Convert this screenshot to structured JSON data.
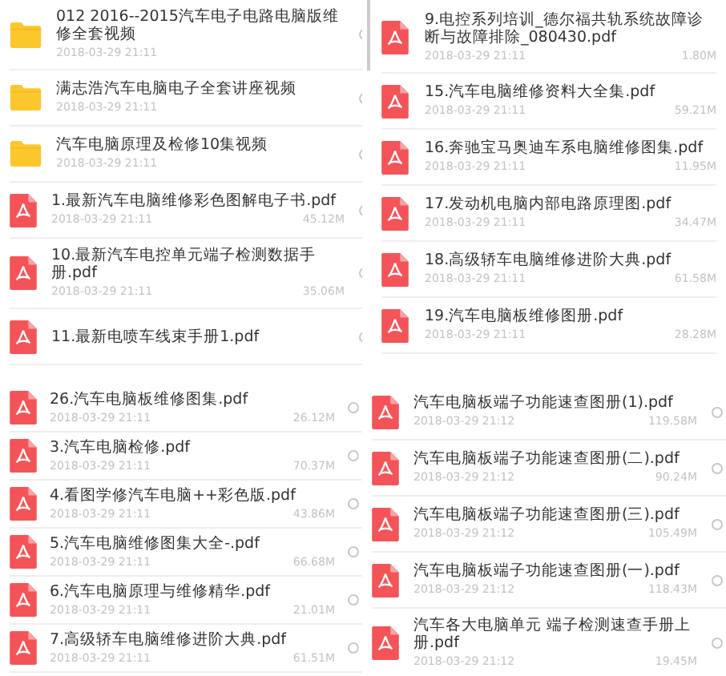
{
  "panels": [
    {
      "rows": [
        {
          "kind": "folder",
          "name": "012 2016--2015汽车电子电路电脑版维修全套视频",
          "date": "2018-03-29 21:11",
          "selected": false
        },
        {
          "kind": "folder",
          "name": "满志浩汽车电脑电子全套讲座视频",
          "date": "2018-03-29 21:11",
          "selected": false
        },
        {
          "kind": "folder",
          "name": "汽车电脑原理及检修10集视频",
          "date": "2018-03-29 21:11",
          "selected": false
        },
        {
          "kind": "pdf",
          "name": "1.最新汽车电脑维修彩色图解电子书.pdf",
          "date": "2018-03-29 21:11",
          "size": "45.12M",
          "selected": false
        },
        {
          "kind": "pdf",
          "name": "10.最新汽车电控单元端子检测数据手册.pdf",
          "date": "2018-03-29 21:11",
          "size": "35.06M",
          "selected": false
        },
        {
          "kind": "pdf",
          "name": "11.最新电喷车线束手册1.pdf",
          "selected": false
        }
      ]
    },
    {
      "scrollbar": true,
      "rows": [
        {
          "kind": "pdf",
          "name": "9.电控系列培训_德尔福共轨系统故障诊断与故障排除_080430.pdf",
          "date": "2018-03-29 21:11",
          "size": "1.80M"
        },
        {
          "kind": "pdf",
          "name": "15.汽车电脑维修资料大全集.pdf",
          "date": "2018-03-29 21:11",
          "size": "59.21M"
        },
        {
          "kind": "pdf",
          "name": "16.奔驰宝马奥迪车系电脑维修图集.pdf",
          "date": "2018-03-29 21:11",
          "size": "11.95M"
        },
        {
          "kind": "pdf",
          "name": "17.发动机电脑内部电路原理图.pdf",
          "date": "2018-03-29 21:11",
          "size": "34.47M"
        },
        {
          "kind": "pdf",
          "name": "18.高级轿车电脑维修进阶大典.pdf",
          "date": "2018-03-29 21:11",
          "size": "61.58M"
        },
        {
          "kind": "pdf",
          "name": "19.汽车电脑板维修图册.pdf",
          "date": "2018-03-29 21:11",
          "size": "28.28M"
        }
      ]
    },
    {
      "rows": [
        {
          "kind": "pdf",
          "name": "26.汽车电脑板维修图集.pdf",
          "date": "2018-03-29 21:11",
          "size": "26.12M",
          "selected": false
        },
        {
          "kind": "pdf",
          "name": "3.汽车电脑检修.pdf",
          "date": "2018-03-29 21:11",
          "size": "70.37M",
          "selected": false
        },
        {
          "kind": "pdf",
          "name": "4.看图学修汽车电脑++彩色版.pdf",
          "date": "2018-03-29 21:11",
          "size": "43.86M",
          "selected": false
        },
        {
          "kind": "pdf",
          "name": "5.汽车电脑维修图集大全-.pdf",
          "date": "2018-03-29 21:11",
          "size": "66.68M",
          "selected": false
        },
        {
          "kind": "pdf",
          "name": "6.汽车电脑原理与维修精华.pdf",
          "date": "2018-03-29 21:11",
          "size": "21.01M",
          "selected": false
        },
        {
          "kind": "pdf",
          "name": "7.高级轿车电脑维修进阶大典.pdf",
          "date": "2018-03-29 21:11",
          "size": "61.51M",
          "selected": false
        }
      ]
    },
    {
      "rows": [
        {
          "kind": "pdf",
          "name": "汽车电脑板端子功能速查图册(1).pdf",
          "date": "2018-03-29 21:12",
          "size": "119.58M",
          "selected": false
        },
        {
          "kind": "pdf",
          "name": "汽车电脑板端子功能速查图册(二).pdf",
          "date": "2018-03-29 21:12",
          "size": "90.24M",
          "selected": false
        },
        {
          "kind": "pdf",
          "name": "汽车电脑板端子功能速查图册(三).pdf",
          "date": "2018-03-29 21:12",
          "size": "105.49M",
          "selected": false
        },
        {
          "kind": "pdf",
          "name": "汽车电脑板端子功能速查图册(一).pdf",
          "date": "2018-03-29 21:12",
          "size": "118.43M",
          "selected": false
        },
        {
          "kind": "pdf",
          "name": "汽车各大电脑单元 端子检测速查手册上册.pdf",
          "date": "2018-03-29 21:12",
          "size": "19.45M",
          "selected": false
        }
      ]
    }
  ]
}
